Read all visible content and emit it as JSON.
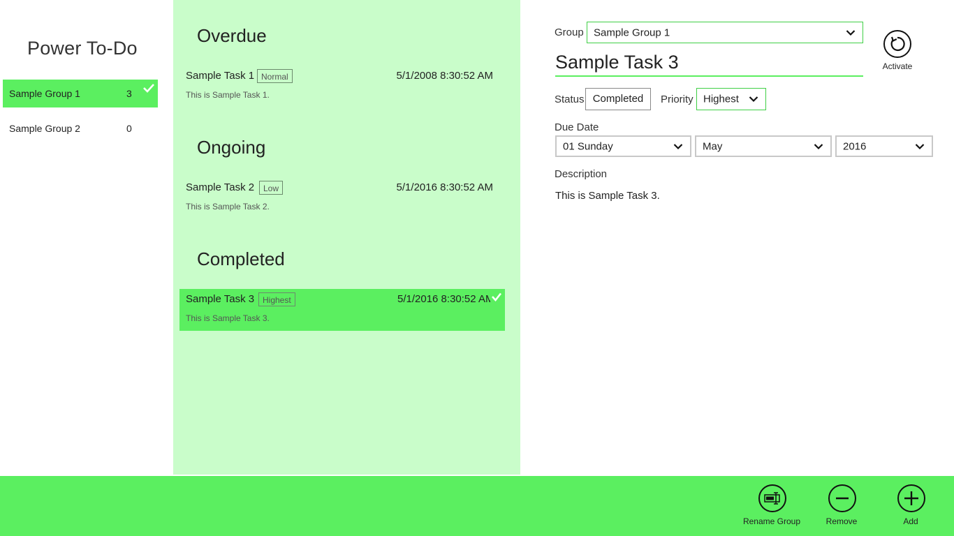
{
  "app": {
    "title": "Power To-Do"
  },
  "groups": [
    {
      "name": "Sample Group 1",
      "count": "3",
      "selected": true
    },
    {
      "name": "Sample Group 2",
      "count": "0",
      "selected": false
    }
  ],
  "sections": [
    {
      "title": "Overdue",
      "tasks": [
        {
          "name": "Sample Task 1",
          "priority": "Normal",
          "date": "5/1/2008 8:30:52 AM",
          "description": "This is Sample Task 1.",
          "selected": false
        }
      ]
    },
    {
      "title": "Ongoing",
      "tasks": [
        {
          "name": "Sample Task 2",
          "priority": "Low",
          "date": "5/1/2016 8:30:52 AM",
          "description": "This is Sample Task 2.",
          "selected": false
        }
      ]
    },
    {
      "title": "Completed",
      "tasks": [
        {
          "name": "Sample Task 3",
          "priority": "Highest",
          "date": "5/1/2016 8:30:52 AM",
          "description": "This is Sample Task 3.",
          "selected": true
        }
      ]
    }
  ],
  "detail": {
    "group_label": "Group",
    "group_value": "Sample Group 1",
    "title": "Sample Task 3",
    "status_label": "Status",
    "status_value": "Completed",
    "priority_label": "Priority",
    "priority_value": "Highest",
    "due_date_label": "Due Date",
    "due_day": "01 Sunday",
    "due_month": "May",
    "due_year": "2016",
    "description_label": "Description",
    "description": "This is Sample Task 3.",
    "activate_label": "Activate"
  },
  "app_bar": {
    "rename_group_label": "Rename Group",
    "remove_label": "Remove",
    "add_label": "Add"
  },
  "colors": {
    "accent": "#5bef60",
    "list_background": "#c9fdca",
    "text": "#222222"
  },
  "icons": {
    "activate": "refresh-icon",
    "rename_group": "rename-icon",
    "remove": "minus-icon",
    "add": "plus-icon",
    "selected_check": "checkmark-icon",
    "dropdown": "chevron-down-icon"
  }
}
